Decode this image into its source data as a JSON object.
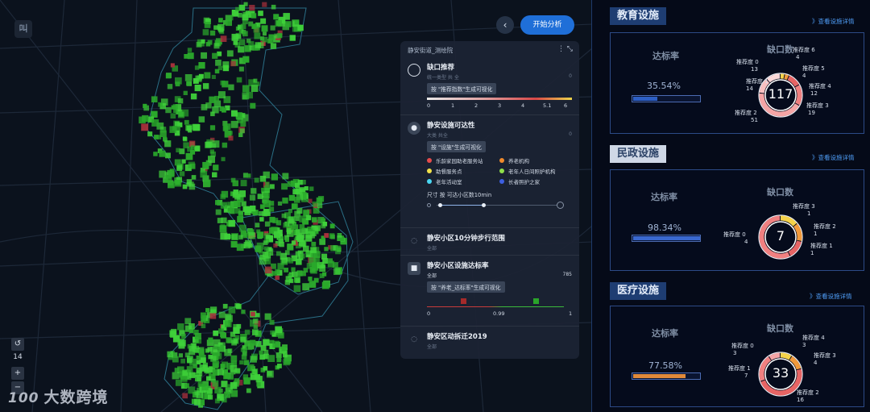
{
  "map": {
    "zoom_level": "14",
    "watermark": "大数跨境",
    "watermark_logo": "100",
    "back_button": "‹",
    "analyze_button": "开始分析",
    "layers_button": "叫"
  },
  "panel": {
    "header": "静安街道_测绘院",
    "header_icons": "⋮  ⤡",
    "sections": [
      {
        "title": "缺口推荐",
        "subtitle": "统一类型 共 全",
        "sub_value": "0",
        "hint": "按 \"推荐指数\"生成可视化",
        "ticks": [
          "0",
          "1",
          "2",
          "3",
          "4",
          "5.1",
          "6"
        ]
      },
      {
        "title": "静安设施可达性",
        "subtitle": "大类 共全",
        "sub_value": "0",
        "hint": "按 \"设施\"生成可视化",
        "legend": [
          {
            "label": "乐龄家园助老服务站",
            "color": "#e64c4c"
          },
          {
            "label": "养老机构",
            "color": "#f08a2c"
          },
          {
            "label": "助餐服务点",
            "color": "#f2e24a"
          },
          {
            "label": "老年人日间照护机构",
            "color": "#8fe04a"
          },
          {
            "label": "老年活动室",
            "color": "#4ad7f2"
          },
          {
            "label": "长者照护之家",
            "color": "#3d5fe0"
          }
        ],
        "size_label": "尺寸 按 可达小区数10min"
      },
      {
        "title": "静安小区10分钟步行范围",
        "subtitle": "全部"
      },
      {
        "title": "静安小区设施达标率",
        "subtitle": "全部",
        "sub_value": "785",
        "hint": "按 \"养老_达标率\"生成可视化",
        "ticks": [
          "0",
          "0.99",
          "1"
        ]
      },
      {
        "title": "静安区动拆迁2019",
        "subtitle": "全部"
      }
    ]
  },
  "cards": [
    {
      "title": "教育设施",
      "link": "》查看设施详情",
      "rate_label": "达标率",
      "gap_label": "缺口数",
      "rate_value": "35.54%",
      "rate_fraction": 0.3554,
      "rate_color": "#2d5fc4",
      "total": "117",
      "breakdown": [
        {
          "label": "推荐度 6",
          "value": "4"
        },
        {
          "label": "推荐度 5",
          "value": "4"
        },
        {
          "label": "推荐度 4",
          "value": "12"
        },
        {
          "label": "推荐度 3",
          "value": "19"
        },
        {
          "label": "推荐度 2",
          "value": "51"
        },
        {
          "label": "推荐度 1",
          "value": "14"
        },
        {
          "label": "推荐度 0",
          "value": "13"
        }
      ]
    },
    {
      "title": "民政设施",
      "link": "》查看设施详情",
      "rate_label": "达标率",
      "gap_label": "缺口数",
      "rate_value": "98.34%",
      "rate_fraction": 0.9834,
      "rate_color": "#3a68cf",
      "total": "7",
      "breakdown": [
        {
          "label": "推荐度 3",
          "value": "1"
        },
        {
          "label": "推荐度 2",
          "value": "1"
        },
        {
          "label": "推荐度 1",
          "value": "1"
        },
        {
          "label": "推荐度 0",
          "value": "4"
        }
      ]
    },
    {
      "title": "医疗设施",
      "link": "》查看设施详情",
      "rate_label": "达标率",
      "gap_label": "缺口数",
      "rate_value": "77.58%",
      "rate_fraction": 0.7758,
      "rate_color": "#e0893a",
      "total": "33",
      "breakdown": [
        {
          "label": "推荐度 4",
          "value": "3"
        },
        {
          "label": "推荐度 3",
          "value": "4"
        },
        {
          "label": "推荐度 2",
          "value": "16"
        },
        {
          "label": "推荐度 1",
          "value": "7"
        },
        {
          "label": "推荐度 0",
          "value": "3"
        }
      ]
    }
  ]
}
